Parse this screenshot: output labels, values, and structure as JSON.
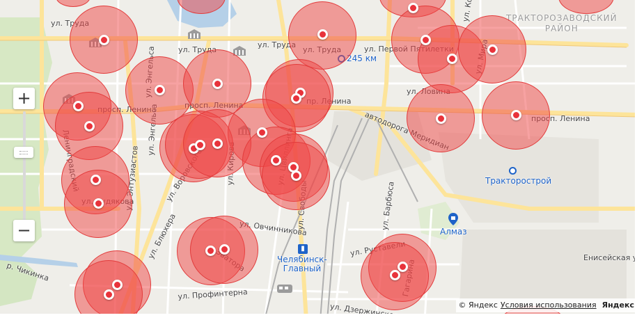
{
  "labels": {
    "district": [
      "ТРАКТОРОЗАВОДСКИЙ",
      "РАЙОН"
    ],
    "streets": {
      "trudy_w": "ул. Труда",
      "trudy_mid": "ул. Труда",
      "trudy_c": "ул. Труда",
      "trudy_e": "ул. Труда",
      "pervoy_pyatiletki": "ул. Первой Пятилетки",
      "engelsa": "ул. Энгельса",
      "engelsa2": "ул. Энгельса",
      "lenina_w": "просп. Ленина",
      "lenina_c": "просп. Ленина",
      "lenina_mid": "пр. Ленина",
      "lenina_e": "просп. Ленина",
      "lovina": "ул. Ловина",
      "avtodoroga": "автодорога Меридиан",
      "vorovskogo": "ул. Воровского",
      "svobody": "ул. Свободы",
      "ovchinnikova": "ул. Овчинникова",
      "blyukhera": "ул. Блюхера",
      "entuziastov": "ул. Энтузиастов",
      "khudyakova": "ул. Худякова",
      "tsvillinga": "ул. Цвиллинга",
      "kosareva": "ул. Косарева",
      "rustaveli": "ул. Руставели",
      "barbyusa": "ул. Барбюса",
      "profintern": "ул. Профинтерна",
      "dzerzhinskogo": "ул. Дзержинского",
      "eniseyskaya": "Енисейская ул.",
      "chikinka": "р. Чикинка",
      "kirova": "ул. Кирова",
      "mira": "ул. Мира",
      "zvatora": "Эватора",
      "gagarina": "Гагарина",
      "leninagrad": "Ленинградский",
      "km": "245 км"
    },
    "places": {
      "traktorostroy": "Тракторострой",
      "almaz": "Алмаз",
      "station_line1": "Челябинск-",
      "station_line2": "Главный"
    }
  },
  "controls": {
    "zoom_in": "+",
    "zoom_out": "−"
  },
  "copyright": {
    "text": "© Яндекс",
    "terms": "Условия использования",
    "logo": "Яндекс"
  },
  "colors": {
    "circle_fill": "#f04646",
    "circle_stroke": "#e23b3b",
    "dot": "#e8333b",
    "road_major": "#fde49a",
    "park": "#d7e8c4",
    "water": "#b5d0e8",
    "metro_blue": "#1e63c8"
  }
}
